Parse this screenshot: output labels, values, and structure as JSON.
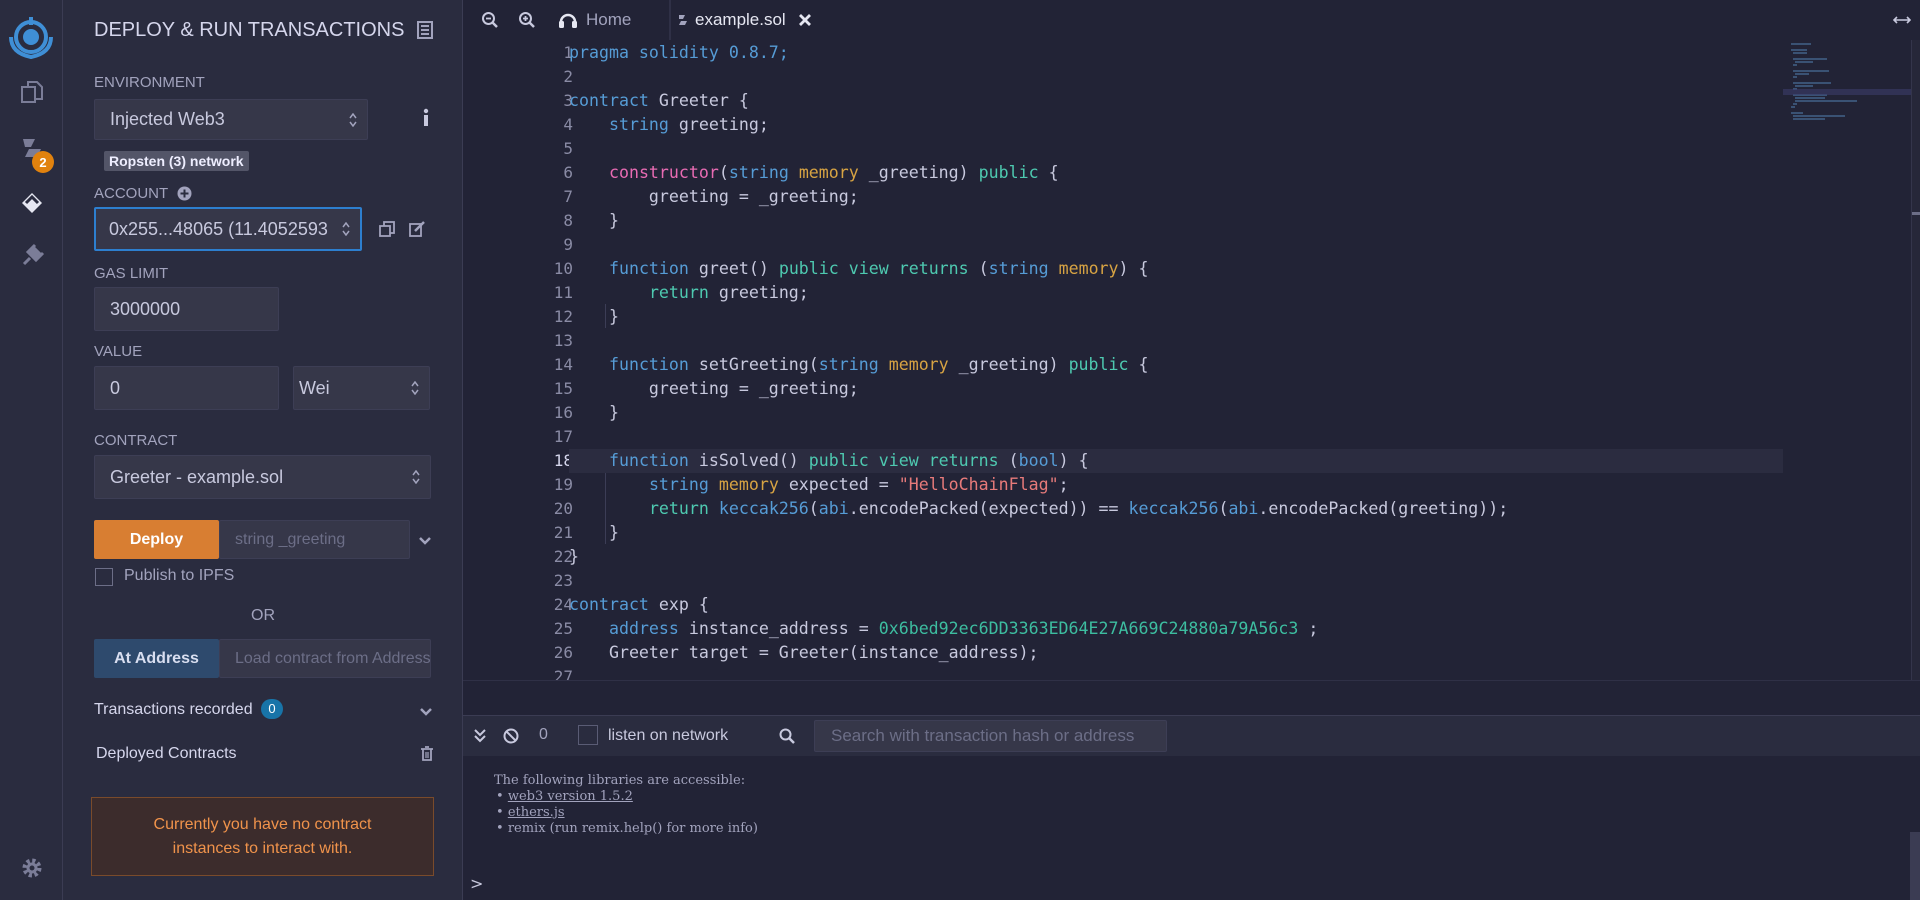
{
  "rail": {
    "icons": [
      "remix-logo-icon",
      "file-explorer-icon",
      "solidity-compiler-icon",
      "deploy-run-icon",
      "plugin-manager-icon",
      "settings-gear-icon"
    ],
    "compiler_badge": "2"
  },
  "panel": {
    "title": "DEPLOY & RUN TRANSACTIONS",
    "environment_label": "ENVIRONMENT",
    "environment_value": "Injected Web3",
    "network_badge": "Ropsten (3) network",
    "account_label": "ACCOUNT",
    "account_value": "0x255...48065 (11.4052593",
    "gas_limit_label": "GAS LIMIT",
    "gas_limit_value": "3000000",
    "value_label": "VALUE",
    "value_amount": "0",
    "value_unit": "Wei",
    "contract_label": "CONTRACT",
    "contract_value": "Greeter - example.sol",
    "deploy_label": "Deploy",
    "deploy_placeholder": "string _greeting",
    "publish_ipfs_label": "Publish to IPFS",
    "or_label": "OR",
    "at_address_label": "At Address",
    "at_address_placeholder": "Load contract from Address",
    "transactions_label": "Transactions recorded",
    "transactions_count": "0",
    "deployed_label": "Deployed Contracts",
    "no_instances_line1": "Currently you have no contract",
    "no_instances_line2": "instances to interact with."
  },
  "tabs": {
    "home": "Home",
    "file": "example.sol"
  },
  "editor": {
    "current_line": 18,
    "lines": [
      [
        [
          "pragma solidity 0.8.7;",
          "blue"
        ]
      ],
      [],
      [
        [
          "contract ",
          "blue"
        ],
        [
          "Greeter {",
          ""
        ]
      ],
      [
        [
          "    ",
          ""
        ],
        [
          "string ",
          "blue"
        ],
        [
          "greeting;",
          ""
        ]
      ],
      [],
      [
        [
          "    ",
          ""
        ],
        [
          "constructor",
          "pink"
        ],
        [
          "(",
          ""
        ],
        [
          "string ",
          "blue"
        ],
        [
          "memory ",
          "orange"
        ],
        [
          "_greeting) ",
          ""
        ],
        [
          "public ",
          "green"
        ],
        [
          "{",
          ""
        ]
      ],
      [
        [
          "        greeting = _greeting;",
          ""
        ]
      ],
      [
        [
          "    }",
          ""
        ]
      ],
      [],
      [
        [
          "    ",
          ""
        ],
        [
          "function ",
          "blue"
        ],
        [
          "greet() ",
          ""
        ],
        [
          "public ",
          "green"
        ],
        [
          "view ",
          "green"
        ],
        [
          "returns ",
          "green"
        ],
        [
          "(",
          ""
        ],
        [
          "string ",
          "blue"
        ],
        [
          "memory",
          "orange"
        ],
        [
          ") {",
          ""
        ]
      ],
      [
        [
          "        ",
          ""
        ],
        [
          "return ",
          "green"
        ],
        [
          "greeting;",
          ""
        ]
      ],
      [
        [
          "    }",
          ""
        ]
      ],
      [],
      [
        [
          "    ",
          ""
        ],
        [
          "function ",
          "blue"
        ],
        [
          "setGreeting(",
          ""
        ],
        [
          "string ",
          "blue"
        ],
        [
          "memory ",
          "orange"
        ],
        [
          "_greeting) ",
          ""
        ],
        [
          "public ",
          "green"
        ],
        [
          "{",
          ""
        ]
      ],
      [
        [
          "        greeting = _greeting;",
          ""
        ]
      ],
      [
        [
          "    }",
          ""
        ]
      ],
      [],
      [
        [
          "    ",
          ""
        ],
        [
          "function ",
          "blue"
        ],
        [
          "isSolved() ",
          ""
        ],
        [
          "public ",
          "green"
        ],
        [
          "view ",
          "green"
        ],
        [
          "returns ",
          "green"
        ],
        [
          "(",
          ""
        ],
        [
          "bool",
          "blue"
        ],
        [
          ") {",
          ""
        ]
      ],
      [
        [
          "        ",
          ""
        ],
        [
          "string ",
          "blue"
        ],
        [
          "memory ",
          "orange"
        ],
        [
          "expected = ",
          ""
        ],
        [
          "\"HelloChainFlag\"",
          "str"
        ],
        [
          ";",
          ""
        ]
      ],
      [
        [
          "        ",
          ""
        ],
        [
          "return ",
          "green"
        ],
        [
          "keccak256",
          "blue"
        ],
        [
          "(",
          ""
        ],
        [
          "abi",
          "blue"
        ],
        [
          ".encodePacked(expected)) == ",
          ""
        ],
        [
          "keccak256",
          "blue"
        ],
        [
          "(",
          ""
        ],
        [
          "abi",
          "blue"
        ],
        [
          ".encodePacked(greeting));",
          ""
        ]
      ],
      [
        [
          "    }",
          ""
        ]
      ],
      [
        [
          "}",
          ""
        ]
      ],
      [],
      [
        [
          "contract ",
          "blue"
        ],
        [
          "exp {",
          ""
        ]
      ],
      [
        [
          "    ",
          ""
        ],
        [
          "address ",
          "blue"
        ],
        [
          "instance_address = ",
          ""
        ],
        [
          "0x6bed92ec6DD3363ED64E27A669C24880a79A56c3",
          "num"
        ],
        [
          " ;",
          ""
        ]
      ],
      [
        [
          "    Greeter target = Greeter(instance_address);",
          ""
        ]
      ],
      []
    ]
  },
  "terminal": {
    "pending_count": "0",
    "listen_label": "listen on network",
    "search_placeholder": "Search with transaction hash or address",
    "intro": "The following libraries are accessible:",
    "libs": [
      "web3 version 1.5.2",
      "ethers.js",
      "remix (run remix.help() for more info)"
    ],
    "prompt": ">"
  },
  "colors": {
    "accent_orange": "#e1820e",
    "deploy_button": "#d87e32",
    "at_address_button": "#2e4a6d",
    "warning_bg": "#3c2c2c",
    "warning_text": "#f0934b"
  }
}
